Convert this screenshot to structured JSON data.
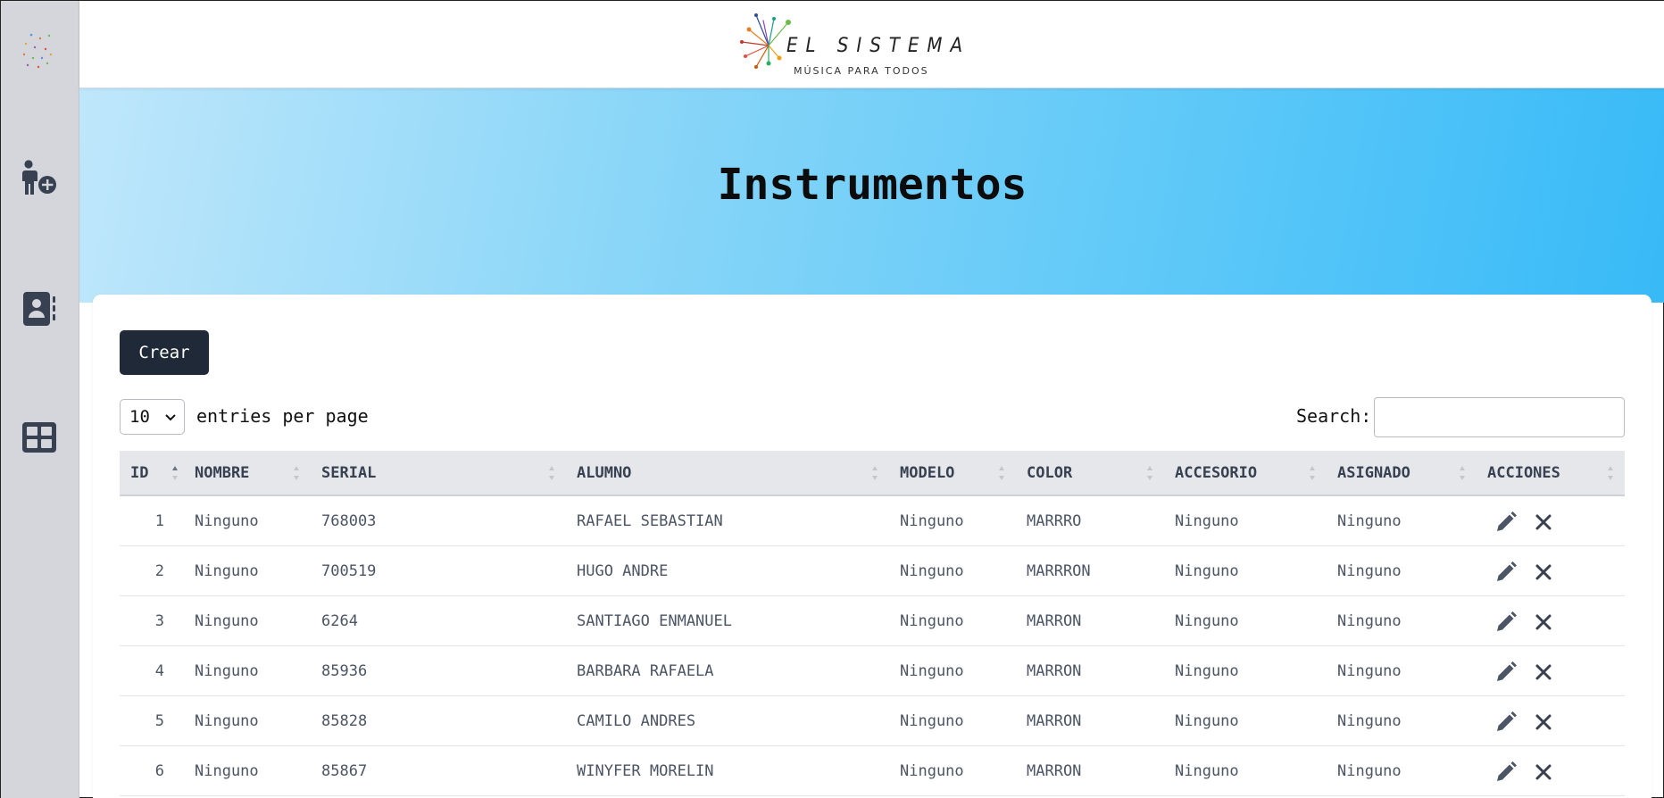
{
  "brand": {
    "name": "EL SISTEMA",
    "tagline": "MÚSICA PARA TODOS"
  },
  "sidebar": {
    "items": [
      {
        "icon": "person-add-icon"
      },
      {
        "icon": "contact-book-icon"
      },
      {
        "icon": "grid-icon"
      }
    ]
  },
  "page": {
    "title": "Instrumentos",
    "create_label": "Crear",
    "per_page_value": "10",
    "per_page_label": "entries per page",
    "search_label": "Search:",
    "search_value": ""
  },
  "table": {
    "headers": [
      "ID",
      "NOMBRE",
      "SERIAL",
      "ALUMNO",
      "MODELO",
      "COLOR",
      "ACCESORIO",
      "ASIGNADO",
      "ACCIONES"
    ],
    "rows": [
      {
        "id": "1",
        "nombre": "Ninguno",
        "serial": "768003",
        "alumno": "RAFAEL SEBASTIAN",
        "modelo": "Ninguno",
        "color": "MARRRO",
        "accesorio": "Ninguno",
        "asignado": "Ninguno"
      },
      {
        "id": "2",
        "nombre": "Ninguno",
        "serial": "700519",
        "alumno": "HUGO ANDRE",
        "modelo": "Ninguno",
        "color": "MARRRON",
        "accesorio": "Ninguno",
        "asignado": "Ninguno"
      },
      {
        "id": "3",
        "nombre": "Ninguno",
        "serial": "6264",
        "alumno": "SANTIAGO ENMANUEL",
        "modelo": "Ninguno",
        "color": "MARRON",
        "accesorio": "Ninguno",
        "asignado": "Ninguno"
      },
      {
        "id": "4",
        "nombre": "Ninguno",
        "serial": "85936",
        "alumno": "BARBARA RAFAELA",
        "modelo": "Ninguno",
        "color": "MARRON",
        "accesorio": "Ninguno",
        "asignado": "Ninguno"
      },
      {
        "id": "5",
        "nombre": "Ninguno",
        "serial": "85828",
        "alumno": "CAMILO ANDRES",
        "modelo": "Ninguno",
        "color": "MARRON",
        "accesorio": "Ninguno",
        "asignado": "Ninguno"
      },
      {
        "id": "6",
        "nombre": "Ninguno",
        "serial": "85867",
        "alumno": "WINYFER MORELIN",
        "modelo": "Ninguno",
        "color": "MARRON",
        "accesorio": "Ninguno",
        "asignado": "Ninguno"
      }
    ]
  },
  "colors": {
    "sidebar_bg": "#d4d6db",
    "hero_start": "#bfe7fb",
    "hero_end": "#38baf7",
    "button_dark": "#1f2937",
    "table_header_bg": "#e5e7eb"
  }
}
